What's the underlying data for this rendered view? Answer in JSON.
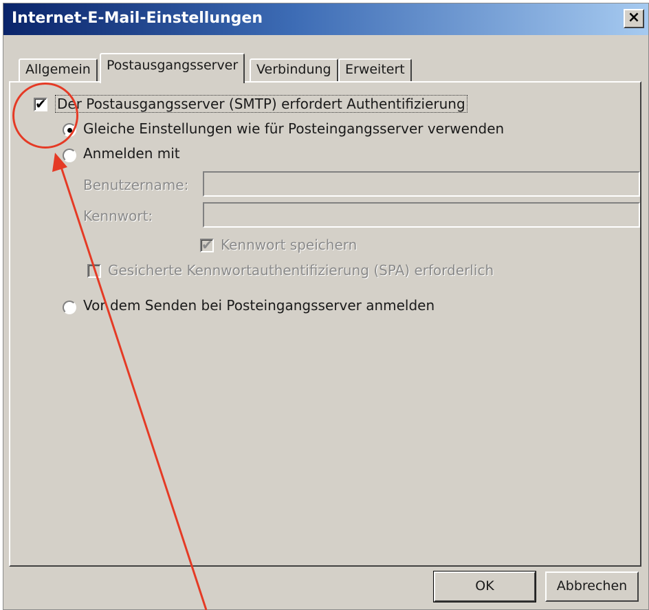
{
  "window": {
    "title": "Internet-E-Mail-Einstellungen",
    "close_glyph": "×"
  },
  "tabs": [
    {
      "label": "Allgemein",
      "active": false
    },
    {
      "label": "Postausgangsserver",
      "active": true
    },
    {
      "label": "Verbindung",
      "active": false
    },
    {
      "label": "Erweitert",
      "active": false
    }
  ],
  "smtp": {
    "auth_checkbox_label": "Der Postausgangsserver (SMTP) erfordert Authentifizierung",
    "auth_checked": true,
    "radio_same_label": "Gleiche Einstellungen wie für Posteingangsserver verwenden",
    "radio_login_label": "Anmelden mit",
    "username_label": "Benutzername:",
    "password_label": "Kennwort:",
    "save_password_label": "Kennwort speichern",
    "spa_label": "Gesicherte Kennwortauthentifizierung (SPA) erforderlich",
    "radio_before_send_label": "Vor dem Senden bei Posteingangsserver anmelden",
    "selected_radio": "same"
  },
  "buttons": {
    "ok": "OK",
    "cancel": "Abbrechen"
  },
  "annotation": {
    "color": "#e53a25"
  },
  "icons": {
    "check": "✔"
  }
}
